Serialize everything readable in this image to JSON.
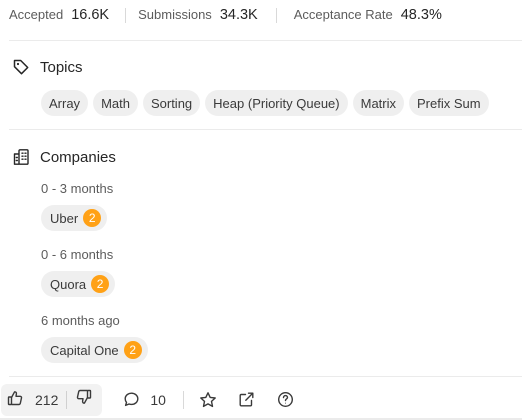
{
  "stats": {
    "accepted_label": "Accepted",
    "accepted_value": "16.6K",
    "submissions_label": "Submissions",
    "submissions_value": "34.3K",
    "acceptance_label": "Acceptance Rate",
    "acceptance_value": "48.3%"
  },
  "topics": {
    "title": "Topics",
    "icon": "tag-icon",
    "tags": [
      "Array",
      "Math",
      "Sorting",
      "Heap (Priority Queue)",
      "Matrix",
      "Prefix Sum"
    ]
  },
  "companies": {
    "title": "Companies",
    "icon": "building-icon",
    "groups": [
      {
        "period": "0 - 3 months",
        "company": "Uber",
        "count": "2"
      },
      {
        "period": "0 - 6 months",
        "company": "Quora",
        "count": "2"
      },
      {
        "period": "6 months ago",
        "company": "Capital One",
        "count": "2"
      }
    ]
  },
  "footer": {
    "likes": "212",
    "comments": "10",
    "icons": [
      "thumbs-up-icon",
      "thumbs-down-icon",
      "comment-icon",
      "star-icon",
      "share-icon",
      "help-icon"
    ]
  },
  "colors": {
    "badge": "#ffa116",
    "tag_bg": "#efefef",
    "text": "#262626",
    "muted": "#5c5c5c"
  }
}
